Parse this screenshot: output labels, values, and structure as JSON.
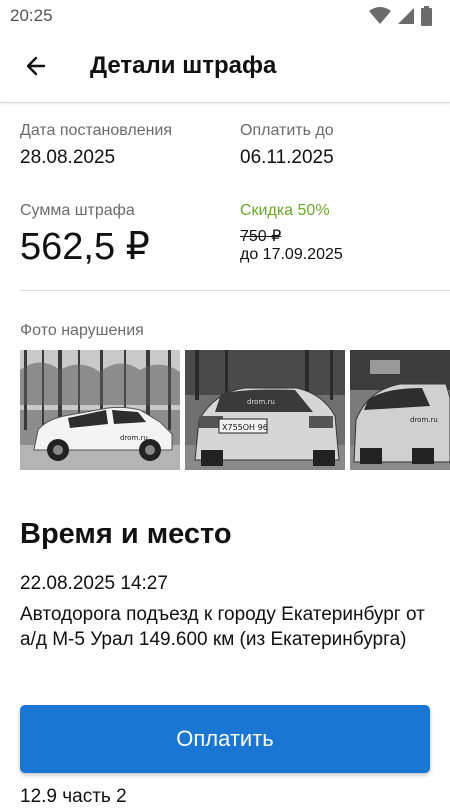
{
  "status_bar": {
    "time": "20:25"
  },
  "header": {
    "title": "Детали штрафа"
  },
  "details": {
    "issue_date_label": "Дата постановления",
    "issue_date": "28.08.2025",
    "pay_until_label": "Оплатить до",
    "pay_until": "06.11.2025",
    "amount_label": "Сумма штрафа",
    "amount": "562,5 ₽",
    "discount_label": "Скидка 50%",
    "original_amount": "750 ₽",
    "discount_until": "до 17.09.2025"
  },
  "photos": {
    "label": "Фото нарушения",
    "items": [
      {
        "plate": "",
        "logo": "drom.ru"
      },
      {
        "plate": "Х755ОН 96",
        "logo": "drom.ru"
      },
      {
        "plate": "",
        "logo": "drom.ru"
      }
    ]
  },
  "place": {
    "title": "Время и место",
    "datetime": "22.08.2025 14:27",
    "address": "Автодорога подъезд к городу Екатеринбург от а/д М-5 Урал 149.600 км (из Екатеринбурга)"
  },
  "pay_button": {
    "label": "Оплатить"
  },
  "article": {
    "text": "12.9 часть 2"
  },
  "colors": {
    "accent": "#1976d2",
    "discount": "#6aa92f"
  }
}
